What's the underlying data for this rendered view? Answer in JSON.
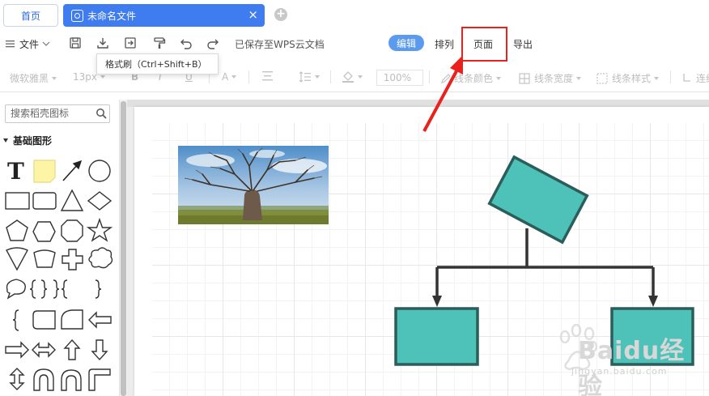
{
  "tabs": {
    "home": "首页",
    "file": "未命名文件",
    "close": "×",
    "add": "+"
  },
  "menu": {
    "file": "文件",
    "saved_status": "已保存至WPS云文档",
    "edit": "编辑",
    "arrange": "排列",
    "page": "页面",
    "export": "导出"
  },
  "tooltip": "格式刷（Ctrl+Shift+B）",
  "format_toolbar": {
    "font_family": "微软雅黑",
    "font_size": "13px",
    "bold": "B",
    "italic": "I",
    "underline": "U",
    "font_color": "A",
    "zoom": "100%",
    "line_color": "线条颜色",
    "line_width": "线条宽度",
    "line_style": "线条样式",
    "connector": "连线"
  },
  "sidebar": {
    "search_placeholder": "搜索稻壳图标",
    "category": "基础图形",
    "text_shape": "T"
  },
  "watermark": {
    "brand": "Baidu经验",
    "url": "jingyan.baidu.com"
  },
  "colors": {
    "accent": "#3e7cf0",
    "highlight": "#e8231d",
    "shape_fill": "#4ec2b8",
    "shape_stroke": "#2b5e5b",
    "connector": "#333333"
  }
}
